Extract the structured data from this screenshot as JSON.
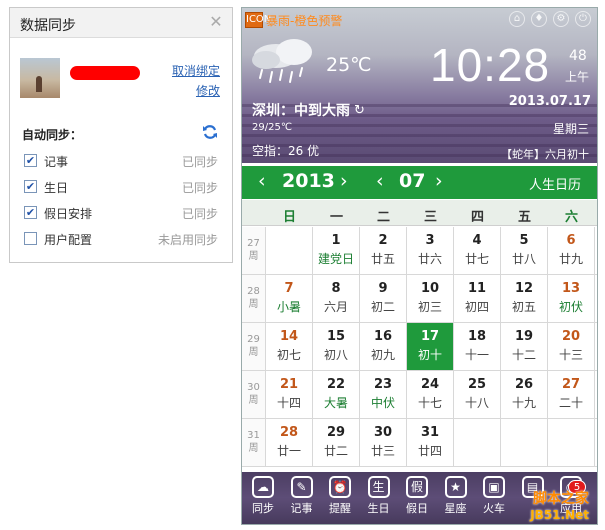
{
  "sync_panel": {
    "title": "数据同步",
    "close_glyph": "✕",
    "unbind_link": "取消绑定",
    "modify_link": "修改",
    "auto_sync_label": "自动同步：",
    "rows": [
      {
        "label": "记事",
        "checked": true,
        "status": "已同步"
      },
      {
        "label": "生日",
        "checked": true,
        "status": "已同步"
      },
      {
        "label": "假日安排",
        "checked": true,
        "status": "已同步"
      },
      {
        "label": "用户配置",
        "checked": false,
        "status": "未启用同步"
      }
    ]
  },
  "weather": {
    "alert_icon": "ICON",
    "alert_text": "暴雨-橙色预警",
    "temperature": "25℃",
    "city_weather": "深圳：中到大雨",
    "temp_range": "29/25℃",
    "air_quality": "空指：26 优",
    "icon": "rain-cloud-icon"
  },
  "clock": {
    "time": "10:28",
    "seconds": "48",
    "ampm": "上午",
    "date": "2013.07.17",
    "weekday": "星期三",
    "lunar": "【蛇年】六月初十"
  },
  "nav": {
    "year": "2013",
    "month": "07",
    "almanac": "人生日历",
    "prev": "‹",
    "next": "›"
  },
  "weekdays": [
    "日",
    "一",
    "二",
    "三",
    "四",
    "五",
    "六"
  ],
  "weeks": [
    {
      "num": "27",
      "unit": "周",
      "days": [
        null,
        {
          "d": "1",
          "l": "建党日",
          "fest": true
        },
        {
          "d": "2",
          "l": "廿五"
        },
        {
          "d": "3",
          "l": "廿六"
        },
        {
          "d": "4",
          "l": "廿七"
        },
        {
          "d": "5",
          "l": "廿八"
        },
        {
          "d": "6",
          "l": "廿九",
          "wknd": true
        }
      ]
    },
    {
      "num": "28",
      "unit": "周",
      "days": [
        {
          "d": "7",
          "l": "小暑",
          "wknd": true,
          "fest": true
        },
        {
          "d": "8",
          "l": "六月"
        },
        {
          "d": "9",
          "l": "初二"
        },
        {
          "d": "10",
          "l": "初三"
        },
        {
          "d": "11",
          "l": "初四"
        },
        {
          "d": "12",
          "l": "初五"
        },
        {
          "d": "13",
          "l": "初伏",
          "wknd": true,
          "fest": true
        }
      ]
    },
    {
      "num": "29",
      "unit": "周",
      "days": [
        {
          "d": "14",
          "l": "初七",
          "wknd": true
        },
        {
          "d": "15",
          "l": "初八"
        },
        {
          "d": "16",
          "l": "初九"
        },
        {
          "d": "17",
          "l": "初十",
          "today": true
        },
        {
          "d": "18",
          "l": "十一"
        },
        {
          "d": "19",
          "l": "十二"
        },
        {
          "d": "20",
          "l": "十三",
          "wknd": true
        }
      ]
    },
    {
      "num": "30",
      "unit": "周",
      "days": [
        {
          "d": "21",
          "l": "十四",
          "wknd": true
        },
        {
          "d": "22",
          "l": "大暑",
          "fest": true
        },
        {
          "d": "23",
          "l": "中伏",
          "fest": true
        },
        {
          "d": "24",
          "l": "十七"
        },
        {
          "d": "25",
          "l": "十八"
        },
        {
          "d": "26",
          "l": "十九"
        },
        {
          "d": "27",
          "l": "二十",
          "wknd": true
        }
      ]
    },
    {
      "num": "31",
      "unit": "周",
      "days": [
        {
          "d": "28",
          "l": "廿一",
          "wknd": true
        },
        {
          "d": "29",
          "l": "廿二"
        },
        {
          "d": "30",
          "l": "廿三"
        },
        {
          "d": "31",
          "l": "廿四"
        },
        null,
        null,
        null
      ]
    }
  ],
  "toolbar": [
    {
      "label": "同步",
      "icon": "cloud-icon",
      "glyph": "☁"
    },
    {
      "label": "记事",
      "icon": "note-icon",
      "glyph": "✎"
    },
    {
      "label": "提醒",
      "icon": "alarm-icon",
      "glyph": "⏰"
    },
    {
      "label": "生日",
      "icon": "birthday-icon",
      "glyph": "生"
    },
    {
      "label": "假日",
      "icon": "holiday-icon",
      "glyph": "假"
    },
    {
      "label": "星座",
      "icon": "star-icon",
      "glyph": "★"
    },
    {
      "label": "火车",
      "icon": "train-icon",
      "glyph": "▣"
    },
    {
      "label": "",
      "icon": "book-icon",
      "glyph": "▤"
    },
    {
      "label": "应用",
      "icon": "clock-icon",
      "glyph": "◔"
    }
  ],
  "badge_count": "5",
  "watermark": {
    "line1": "脚本之家",
    "line2": "JB51.Net"
  },
  "colors": {
    "accent_green": "#1f9a3c",
    "weekend_orange": "#c2571a",
    "alert_orange": "#ff8a1c"
  }
}
